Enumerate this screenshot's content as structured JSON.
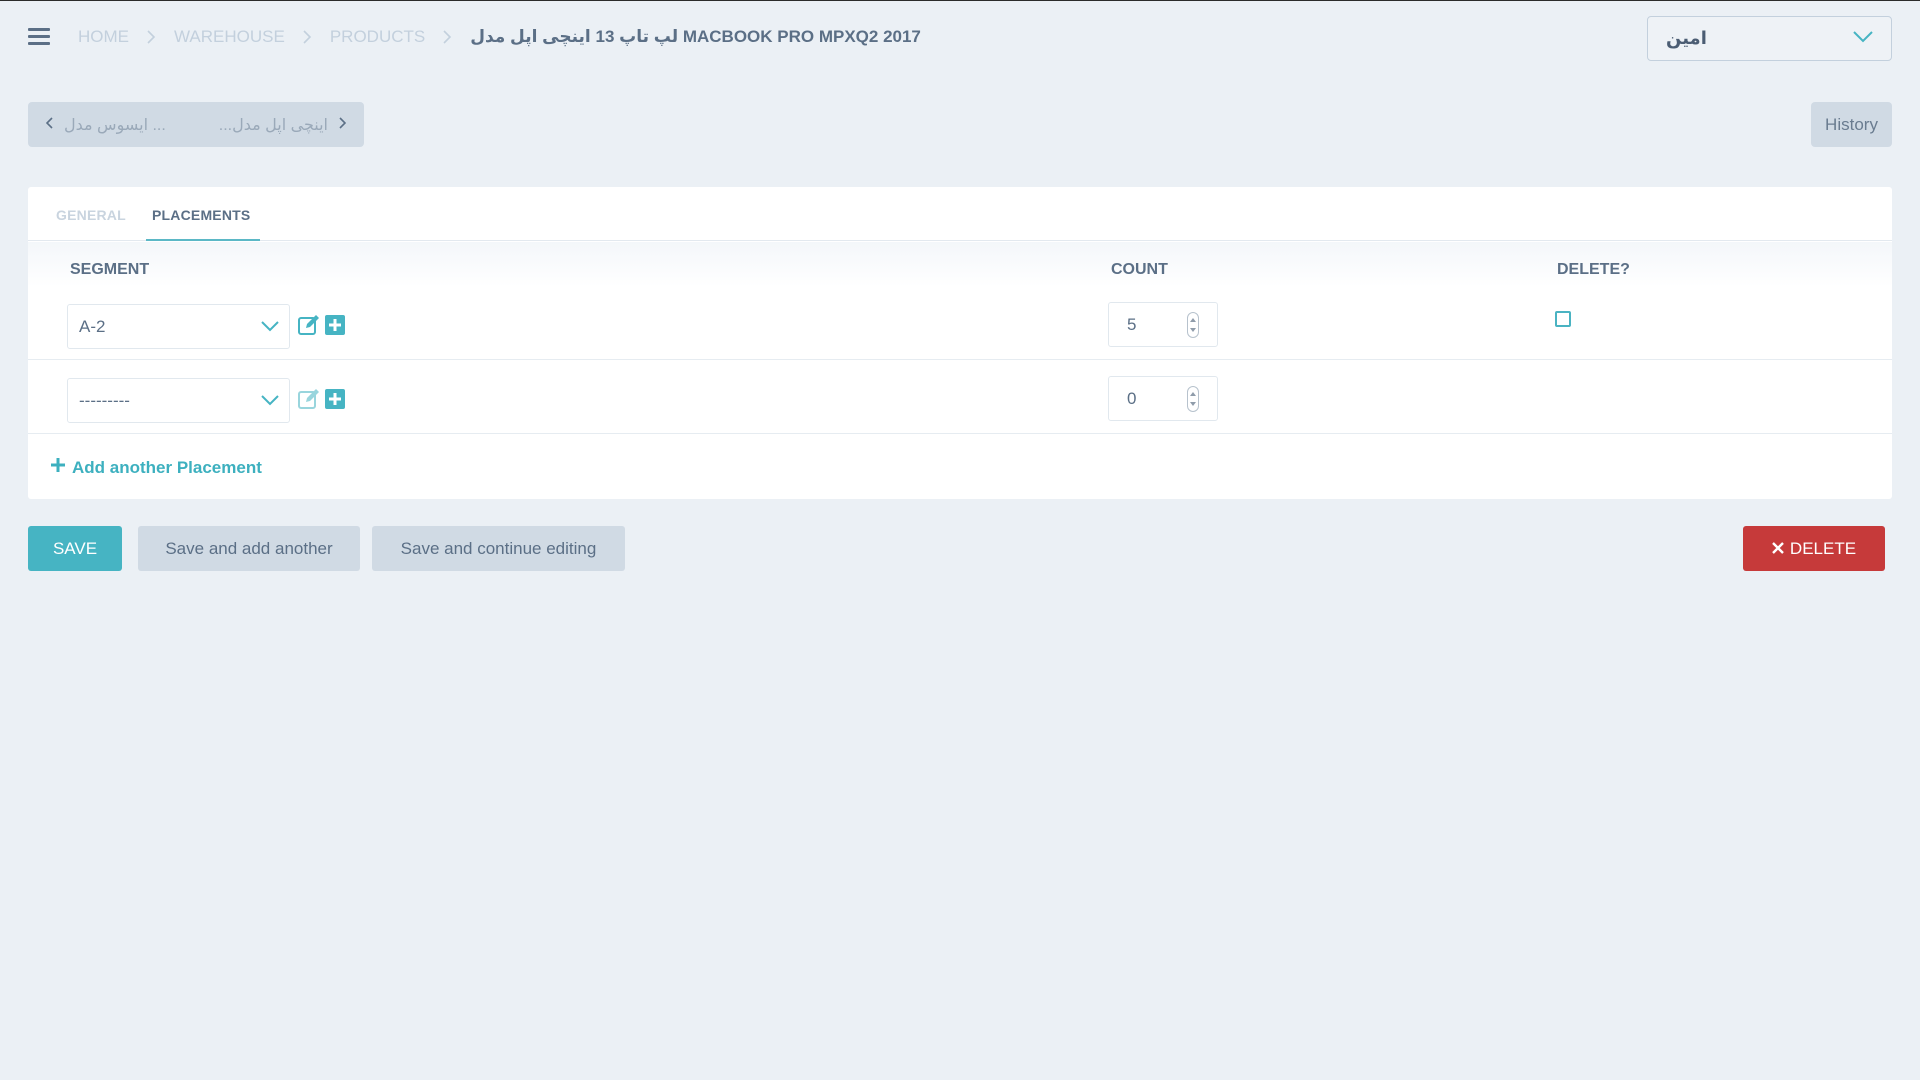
{
  "header": {
    "breadcrumb": [
      {
        "label": "HOME"
      },
      {
        "label": "WAREHOUSE"
      },
      {
        "label": "PRODUCTS"
      }
    ],
    "current": "لپ تاپ 13 اینچی اپل مدل MACBOOK PRO MPXQ2 2017",
    "user": "امین"
  },
  "object_nav": {
    "previous_label": "ایسوس مدل ...",
    "next_label": "...اینچی اپل مدل"
  },
  "history_label": "History",
  "tabs": [
    {
      "label": "GENERAL",
      "active": false
    },
    {
      "label": "PLACEMENTS",
      "active": true
    }
  ],
  "table": {
    "columns": [
      "SEGMENT",
      "COUNT",
      "DELETE?"
    ],
    "rows": [
      {
        "segment": "A-2",
        "count": "5",
        "delete": false
      },
      {
        "segment": "---------",
        "count": "0"
      }
    ],
    "add_label": "Add another Placement"
  },
  "actions": {
    "save": "SAVE",
    "save_add": "Save and add another",
    "save_continue": "Save and continue editing",
    "delete": "DELETE"
  },
  "colors": {
    "accent": "#46b4c3",
    "danger": "#c63a3a",
    "background": "#ebf0f5"
  }
}
